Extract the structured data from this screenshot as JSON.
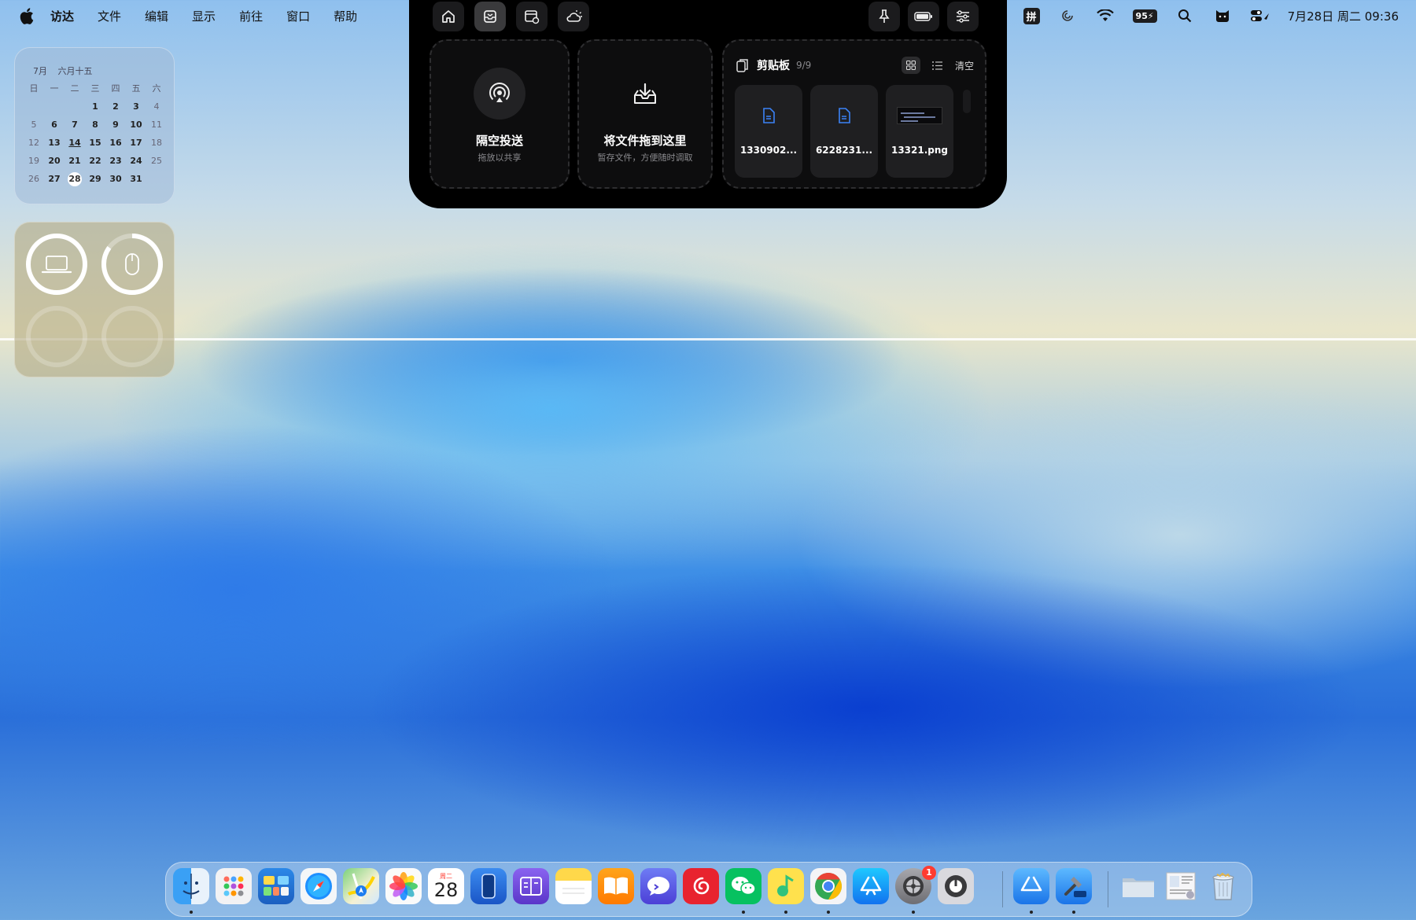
{
  "menubar": {
    "app_name": "访达",
    "items": [
      "文件",
      "编辑",
      "显示",
      "前往",
      "窗口",
      "帮助"
    ],
    "ime_label": "拼",
    "battery_percent": "95",
    "clock": "7月28日 周二  09:36"
  },
  "notch": {
    "airdrop": {
      "title": "隔空投送",
      "subtitle": "拖放以共享"
    },
    "dropzone": {
      "title": "将文件拖到这里",
      "subtitle": "暂存文件，方便随时调取"
    },
    "clipboard": {
      "title": "剪贴板",
      "count": "9/9",
      "clear_label": "清空",
      "items": [
        {
          "name": "1330902...",
          "kind": "document"
        },
        {
          "name": "6228231...",
          "kind": "document"
        },
        {
          "name": "13321.png",
          "kind": "image"
        }
      ]
    }
  },
  "calendar_widget": {
    "month": "7月",
    "lunar": "六月十五",
    "weekdays": [
      "日",
      "一",
      "二",
      "三",
      "四",
      "五",
      "六"
    ],
    "days": [
      "",
      "",
      "",
      "1",
      "2",
      "3",
      "4",
      "5",
      "6",
      "7",
      "8",
      "9",
      "10",
      "11",
      "12",
      "13",
      "14",
      "15",
      "16",
      "17",
      "18",
      "19",
      "20",
      "21",
      "22",
      "23",
      "24",
      "25",
      "26",
      "27",
      "28",
      "29",
      "30",
      "31",
      ""
    ],
    "today": "28"
  },
  "battery_widget": {
    "devices": [
      {
        "icon": "laptop-icon",
        "level": 1.0
      },
      {
        "icon": "mouse-icon",
        "level": 0.85
      },
      {
        "icon": "empty-slot",
        "level": 0
      },
      {
        "icon": "empty-slot",
        "level": 0
      }
    ]
  },
  "dock": {
    "calendar_weekday": "周二",
    "calendar_day": "28",
    "settings_badge": "1",
    "apps": [
      "finder-icon",
      "launchpad-icon",
      "mission-control-icon",
      "safari-icon",
      "maps-icon",
      "photos-icon",
      "calendar-icon",
      "iphone-mirroring-icon",
      "notes-app-icon",
      "stickies-icon",
      "books-icon",
      "message-bubble-icon",
      "netease-music-icon",
      "wechat-icon",
      "qq-music-icon",
      "chrome-icon",
      "app-store-icon",
      "system-settings-icon",
      "activity-icon",
      "xcode-icon",
      "xcode-beta-icon",
      "downloads-folder-icon",
      "document-stack-icon",
      "trash-icon"
    ]
  }
}
